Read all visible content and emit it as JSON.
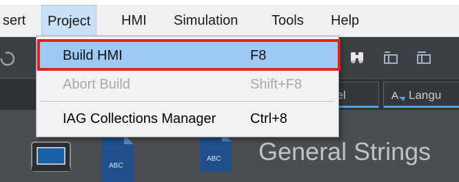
{
  "menubar": {
    "items": [
      {
        "label": "sert"
      },
      {
        "label": "Project"
      },
      {
        "label": "HMI"
      },
      {
        "label": "Simulation"
      },
      {
        "label": "Tools"
      },
      {
        "label": "Help"
      }
    ],
    "active_item": "Project"
  },
  "dropdown": {
    "items": [
      {
        "label": "Build HMI",
        "shortcut": "F8",
        "enabled": true,
        "selected": true
      },
      {
        "label": "Abort Build",
        "shortcut": "Shift+F8",
        "enabled": false,
        "selected": false
      },
      {
        "label": "IAG Collections Manager",
        "shortcut": "Ctrl+8",
        "enabled": true,
        "selected": false
      }
    ]
  },
  "tabs": [
    {
      "label": "nel"
    },
    {
      "label": "Langu"
    }
  ],
  "workspace": {
    "title": "General Strings",
    "icon_badges": [
      "ABC",
      "ABC"
    ]
  },
  "colors": {
    "menubar_bg": "#eef0f2",
    "selected_item_bg": "#9ec9f2",
    "highlight_border": "#e1201f",
    "dark_panel": "#3c3f44",
    "tab_accent": "#4da3e8",
    "icon_blue": "#1f4f8c"
  },
  "icons": [
    "undo-icon",
    "find-icon",
    "tool-icon-1",
    "tool-icon-2",
    "screen-icon",
    "abc-document-icon",
    "language-icon"
  ]
}
